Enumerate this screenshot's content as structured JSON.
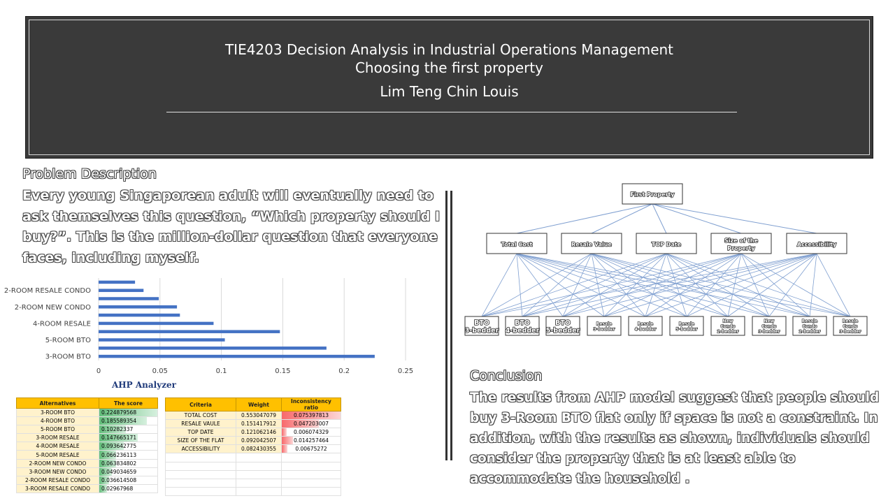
{
  "banner": {
    "title": "TIE4203 Decision Analysis in Industrial Operations Management",
    "subtitle": "Choosing the first property",
    "author": "Lim Teng Chin Louis"
  },
  "problem": {
    "heading": "Problem Description",
    "body": "Every young Singaporean adult will eventually need to ask themselves this question, “Which property should I buy?”. This is the million-dollar question that everyone faces, including myself."
  },
  "conclusion": {
    "heading": "Conclusion",
    "body": "The results from AHP model suggest that people should buy 3-Room BTO flat only if space is not a constraint. In addition, with the results as shown, individuals should consider the property that is at least able to accommodate the household ."
  },
  "chart_data": {
    "type": "bar",
    "orientation": "horizontal",
    "categories": [
      "3-ROOM BTO",
      "4-ROOM BTO",
      "5-ROOM BTO",
      "3-ROOM RESALE",
      "4-ROOM RESALE",
      "5-ROOM RESALE",
      "2-ROOM NEW CONDO",
      "3-ROOM NEW CONDO",
      "2-ROOM RESALE CONDO",
      "3-ROOM RESALE CONDO"
    ],
    "tick_labels_shown": [
      "3-ROOM BTO",
      "",
      "5-ROOM BTO",
      "",
      "4-ROOM RESALE",
      "",
      "2-ROOM NEW CONDO",
      "",
      "2-ROOM RESALE CONDO",
      ""
    ],
    "values": [
      0.224879568,
      0.185589354,
      0.10282337,
      0.147665171,
      0.093642775,
      0.066236113,
      0.063834802,
      0.049034659,
      0.036614508,
      0.02967968
    ],
    "x_ticks": [
      "0",
      "0.05",
      "0.1",
      "0.15",
      "0.2",
      "0.25"
    ],
    "xlim": [
      0,
      0.25
    ],
    "grid": true,
    "bar_color": "#4472c4"
  },
  "ahp": {
    "title": "AHP Analyzer",
    "alt_headers": [
      "Alternatives",
      "The score"
    ],
    "alternatives": [
      {
        "name": "3-ROOM BTO",
        "score": "0.224879568",
        "v": 0.224879568
      },
      {
        "name": "4-ROOM BTO",
        "score": "0.185589354",
        "v": 0.185589354
      },
      {
        "name": "5-ROOM BTO",
        "score": "0.10282337",
        "v": 0.10282337
      },
      {
        "name": "3-ROOM RESALE",
        "score": "0.147665171",
        "v": 0.147665171
      },
      {
        "name": "4-ROOM RESALE",
        "score": "0.093642775",
        "v": 0.093642775
      },
      {
        "name": "5-ROOM RESALE",
        "score": "0.066236113",
        "v": 0.066236113
      },
      {
        "name": "2-ROOM NEW CONDO",
        "score": "0.063834802",
        "v": 0.063834802
      },
      {
        "name": "3-ROOM NEW CONDO",
        "score": "0.049034659",
        "v": 0.049034659
      },
      {
        "name": "2-ROOM RESALE CONDO",
        "score": "0.036614508",
        "v": 0.036614508
      },
      {
        "name": "3-ROOM RESALE CONDO",
        "score": "0.02967968",
        "v": 0.02967968
      }
    ],
    "crit_headers": [
      "Criteria",
      "Weight",
      "Inconsistency ratio"
    ],
    "criteria": [
      {
        "name": "TOTAL COST",
        "weight": "0.553047079",
        "ratio": "0.075397813",
        "r": 0.075397813
      },
      {
        "name": "RESALE VAULE",
        "weight": "0.151417912",
        "ratio": "0.047203007",
        "r": 0.047203007
      },
      {
        "name": "TOP DATE",
        "weight": "0.121062146",
        "ratio": "0.006074329",
        "r": 0.006074329
      },
      {
        "name": "SIZE OF THE FLAT",
        "weight": "0.092042507",
        "ratio": "0.014257464",
        "r": 0.014257464
      },
      {
        "name": "ACCESSIBILITY",
        "weight": "0.082430355",
        "ratio": "0.00675272",
        "r": 0.00675272
      }
    ],
    "score_bar_color": "#63be7b",
    "ratio_bar_color": "#f8696b"
  },
  "hierarchy": {
    "goal": "First Property",
    "criteria": [
      "Total Cost",
      "Resale Value",
      "TOP Date",
      "Size of the Property",
      "Accessibility"
    ],
    "alternatives": [
      "BTO 3-bedder",
      "BTO 4-bedder",
      "BTO 5-bedder",
      "Resale 3-bedder",
      "Resale 4-bedder",
      "Resale 5-bedder",
      "New Condo 2-bedder",
      "New Condo 3-bedder",
      "Resale Condo 2-bedder",
      "Resale Condo 3-bedder"
    ],
    "line_color": "#7f9fd0"
  }
}
